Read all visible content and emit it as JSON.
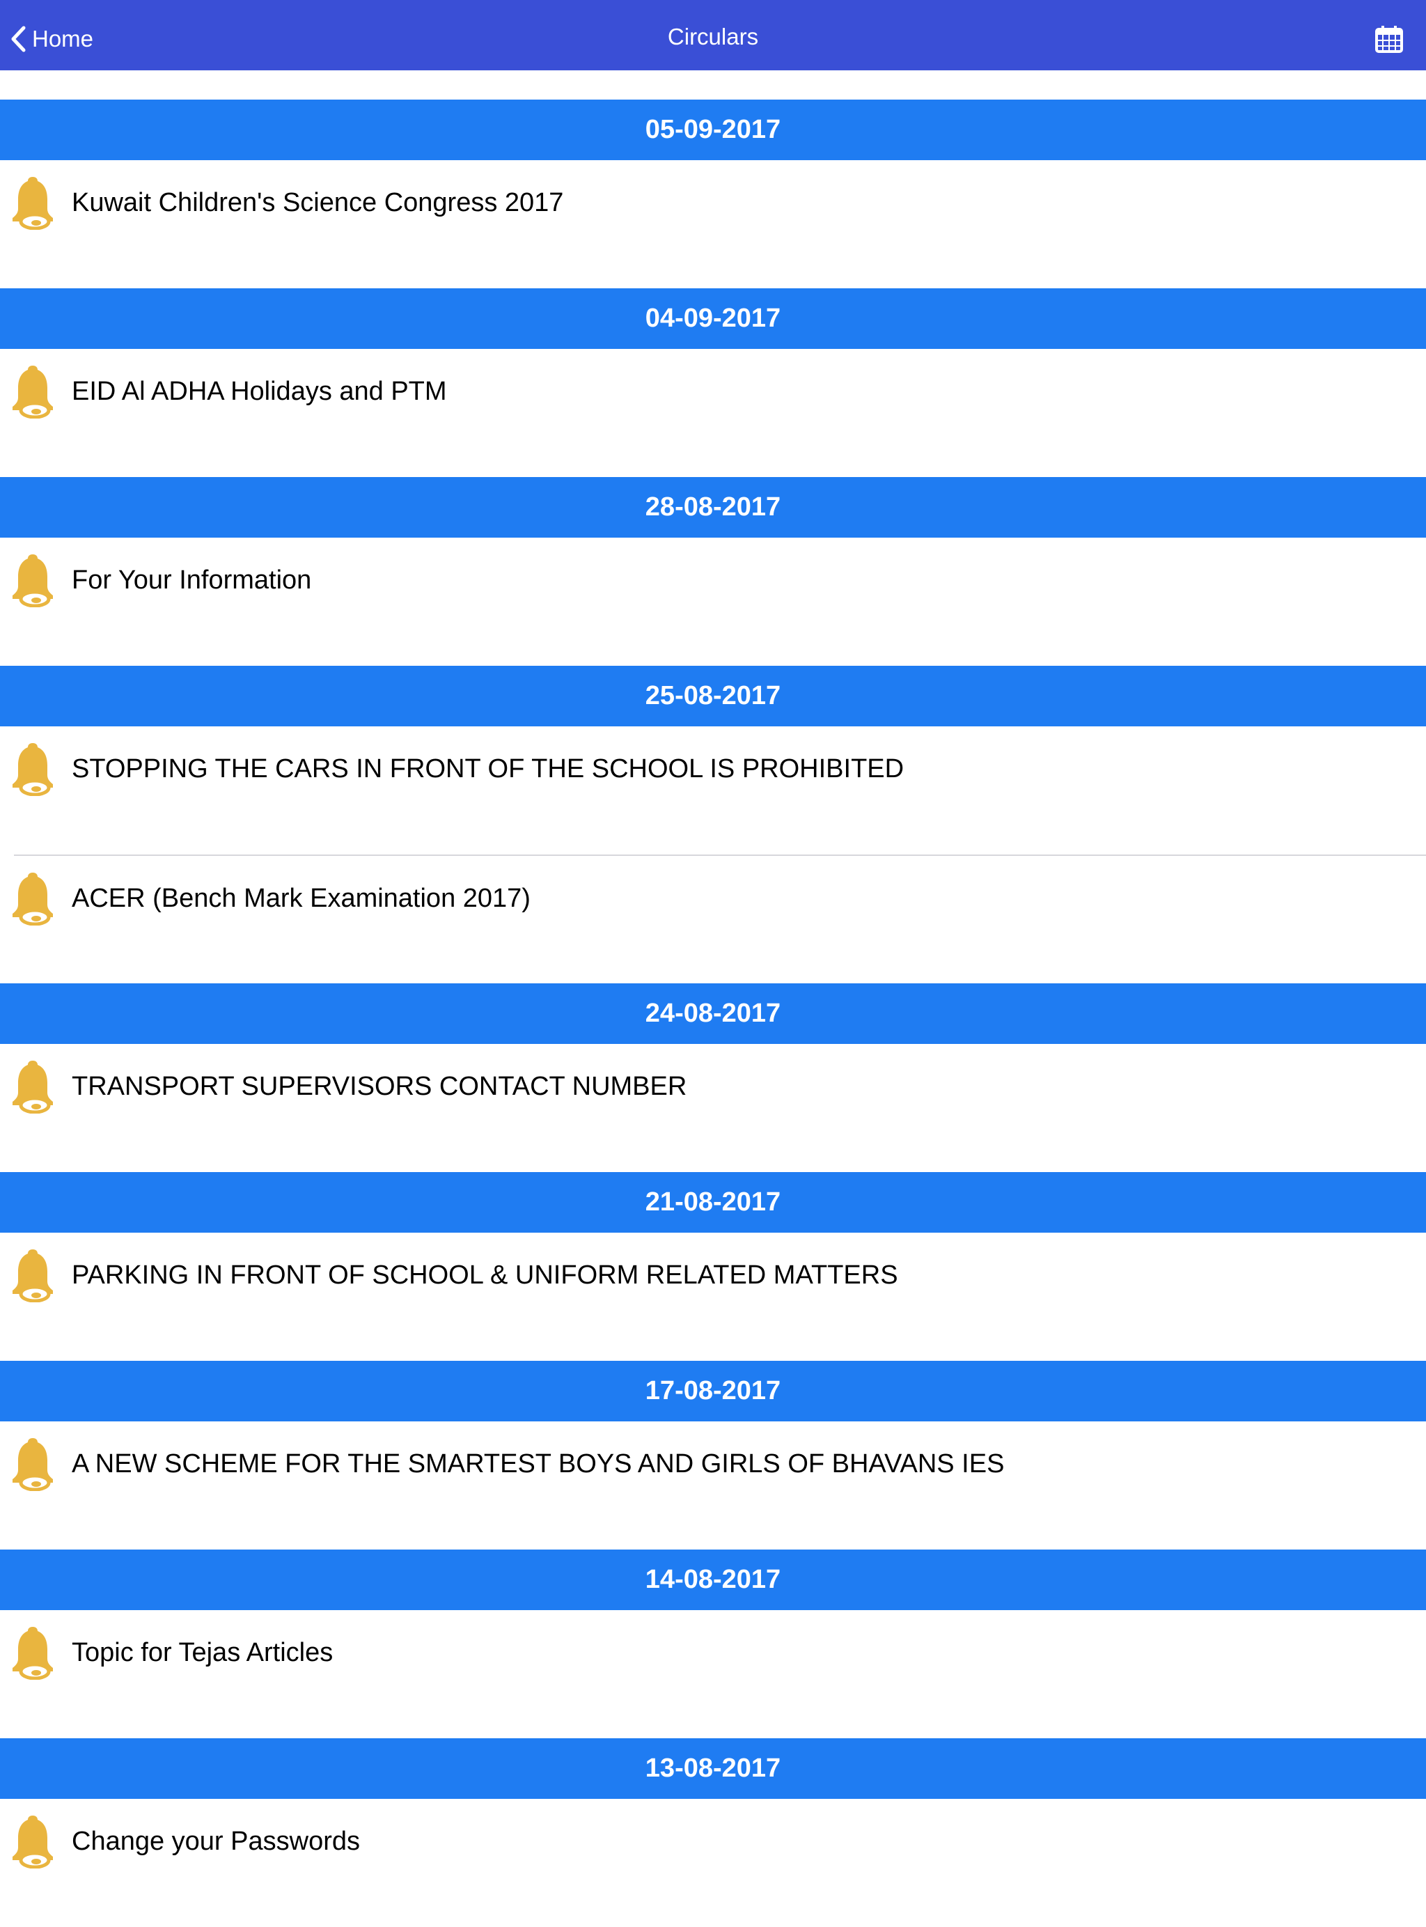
{
  "nav": {
    "back_label": "Home",
    "title": "Circulars",
    "bar_color": "#3a4fd6"
  },
  "colors": {
    "section_header": "#1f7cf2",
    "bell": "#e9b53f"
  },
  "sections": [
    {
      "date": "05-09-2017",
      "items": [
        {
          "title": "Kuwait Children's Science Congress 2017"
        }
      ]
    },
    {
      "date": "04-09-2017",
      "items": [
        {
          "title": "EID Al ADHA Holidays and PTM"
        }
      ]
    },
    {
      "date": "28-08-2017",
      "items": [
        {
          "title": "For Your Information"
        }
      ]
    },
    {
      "date": "25-08-2017",
      "items": [
        {
          "title": "STOPPING THE CARS IN FRONT OF THE SCHOOL IS PROHIBITED"
        },
        {
          "title": "ACER (Bench Mark Examination 2017)"
        }
      ]
    },
    {
      "date": "24-08-2017",
      "items": [
        {
          "title": "TRANSPORT SUPERVISORS CONTACT NUMBER"
        }
      ]
    },
    {
      "date": "21-08-2017",
      "items": [
        {
          "title": "PARKING IN FRONT OF SCHOOL & UNIFORM RELATED MATTERS"
        }
      ]
    },
    {
      "date": "17-08-2017",
      "items": [
        {
          "title": "A NEW SCHEME FOR THE SMARTEST BOYS AND GIRLS OF BHAVANS IES"
        }
      ]
    },
    {
      "date": "14-08-2017",
      "items": [
        {
          "title": "Topic for Tejas Articles"
        }
      ]
    },
    {
      "date": "13-08-2017",
      "items": [
        {
          "title": "Change your Passwords"
        }
      ]
    }
  ],
  "icons": {
    "back": "chevron-left-icon",
    "calendar": "calendar-icon",
    "item": "bell-icon"
  }
}
